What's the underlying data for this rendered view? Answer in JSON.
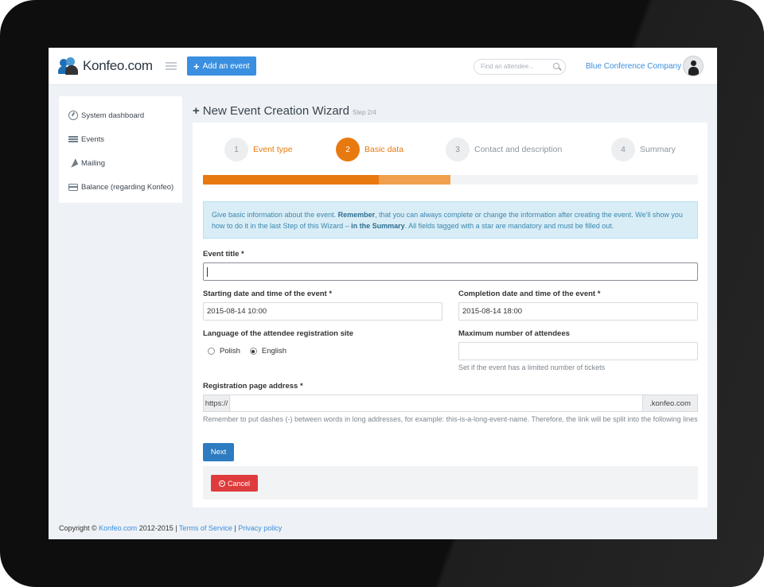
{
  "header": {
    "logo_text": "Konfeo.com",
    "add_event_label": "Add an event",
    "search_placeholder": "Find an attendee...",
    "company_name": "Blue Conference Company"
  },
  "sidebar": {
    "items": [
      {
        "label": "System dashboard",
        "icon": "dashboard-icon"
      },
      {
        "label": "Events",
        "icon": "list-icon"
      },
      {
        "label": "Mailing",
        "icon": "paper-plane-icon"
      },
      {
        "label": "Balance (regarding Konfeo)",
        "icon": "credit-card-icon"
      }
    ]
  },
  "page": {
    "title": "New Event Creation Wizard",
    "step_text": "Step 2/4"
  },
  "wizard": {
    "steps": [
      {
        "num": "1",
        "label": "Event type",
        "state": "done"
      },
      {
        "num": "2",
        "label": "Basic data",
        "state": "active"
      },
      {
        "num": "3",
        "label": "Contact and description",
        "state": "pending"
      },
      {
        "num": "4",
        "label": "Summary",
        "state": "pending"
      }
    ],
    "progress_fraction": 0.5
  },
  "info": {
    "text_1": "Give basic information about the event. ",
    "bold_1": "Remember",
    "text_2": ", that you can always complete or change the information after creating the event. We'll show you how to do it in the last Step of this Wizard – ",
    "bold_2": "in the Summary",
    "text_3": ". All fields tagged with a star are mandatory and must be filled out."
  },
  "form": {
    "event_title_label": "Event title *",
    "event_title_value": "",
    "start_label": "Starting date and time of the event *",
    "start_value": "2015-08-14 10:00",
    "end_label": "Completion date and time of the event *",
    "end_value": "2015-08-14 18:00",
    "language_label": "Language of the attendee registration site",
    "language_options": [
      "Polish",
      "English"
    ],
    "language_selected": "English",
    "max_attendees_label": "Maximum number of attendees",
    "max_attendees_value": "",
    "max_attendees_help": "Set if the event has a limited number of tickets",
    "reg_address_label": "Registration page address *",
    "reg_prefix": "https://",
    "reg_value": "",
    "reg_suffix": ".konfeo.com",
    "reg_help": "Remember to put dashes (-) between words in long addresses, for example: this-is-a-long-event-name. Therefore, the link will be split into the following lines",
    "next_label": "Next",
    "cancel_label": "Cancel"
  },
  "footer": {
    "copyright_prefix": "Copyright © ",
    "site_link": "Konfeo.com",
    "years": " 2012-2015 | ",
    "terms_link": "Terms of Service",
    "separator": " | ",
    "privacy_link": "Privacy policy"
  },
  "colors": {
    "accent_orange": "#e8790f",
    "primary_blue": "#3a8fe0",
    "danger_red": "#de3c3c",
    "info_bg": "#d9edf7"
  }
}
